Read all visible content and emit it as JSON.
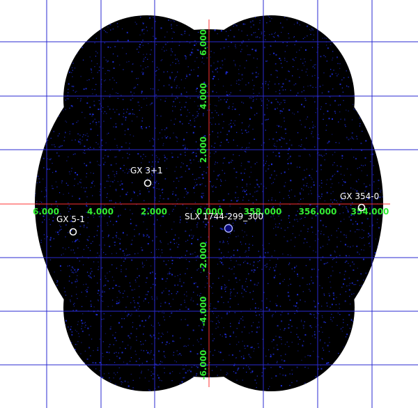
{
  "colors": {
    "background": "#ffffff",
    "field": "#000000",
    "noise": "#1f2fe0",
    "grid": "#2a2ad0",
    "axis": "#ff3030",
    "tick_labels": "#33ee33",
    "source_labels": "#ffffff"
  },
  "x_ticks": [
    "6.000",
    "4.000",
    "2.000",
    "0.000",
    "358.000",
    "356.000",
    "354.000"
  ],
  "y_ticks": [
    "6.000",
    "4.000",
    "2.000",
    "-2.000",
    "-4.000",
    "-6.000"
  ],
  "sources": [
    {
      "name": "GX 3+1",
      "marker": "white-circle"
    },
    {
      "name": "GX 5-1",
      "marker": "white-circle"
    },
    {
      "name": "SLX 1744-299_300",
      "marker": "blue-circle"
    },
    {
      "name": "GX 354-0",
      "marker": "white-circle"
    }
  ]
}
